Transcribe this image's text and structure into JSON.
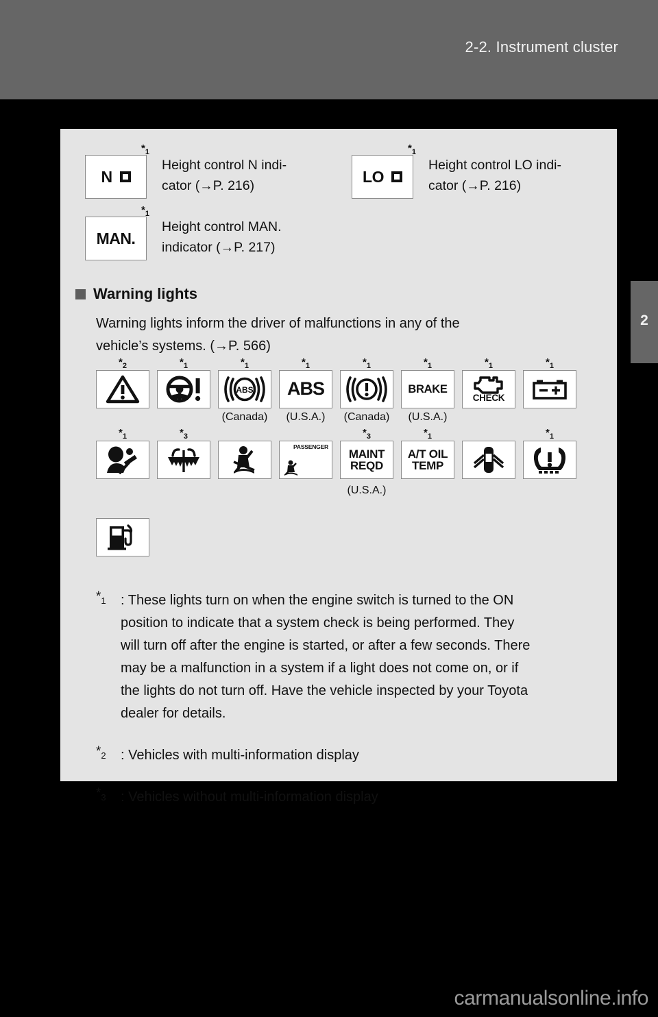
{
  "header": {
    "title": "2-2. Instrument cluster",
    "chapter_tab": "2"
  },
  "indicators": [
    {
      "icon_text": "N",
      "has_square": true,
      "footnote": "1",
      "label_line1": "Height control N indi-",
      "label_line2": "cator (→P. 216)"
    },
    {
      "icon_text": "LO",
      "has_square": true,
      "footnote": "1",
      "label_line1": "Height control LO indi-",
      "label_line2": "cator (→P. 216)"
    },
    {
      "icon_text": "MAN.",
      "has_square": false,
      "footnote": "1",
      "label_line1": "Height control MAN.",
      "label_line2": "indicator (→P. 217)"
    }
  ],
  "section": {
    "heading": "Warning lights",
    "body_line1": "Warning lights inform the driver of malfunctions in any of the",
    "body_line2": "vehicle’s systems. (→P. 566)"
  },
  "warning_lights": {
    "row1": [
      {
        "icon": "warning-triangle-icon",
        "footnote": "2",
        "region": ""
      },
      {
        "icon": "power-steering-icon",
        "footnote": "1",
        "region": ""
      },
      {
        "icon": "abs-circle-icon",
        "footnote": "1",
        "region": "(Canada)"
      },
      {
        "icon": "abs-text-icon",
        "text": "ABS",
        "footnote": "1",
        "region": "(U.S.A.)"
      },
      {
        "icon": "brake-circle-icon",
        "footnote": "1",
        "region": "(Canada)"
      },
      {
        "icon": "brake-text-icon",
        "text": "BRAKE",
        "footnote": "1",
        "region": "(U.S.A.)"
      },
      {
        "icon": "engine-check-icon",
        "text": "CHECK",
        "footnote": "1",
        "region": ""
      },
      {
        "icon": "battery-icon",
        "footnote": "1",
        "region": ""
      }
    ],
    "row2": [
      {
        "icon": "srs-airbag-icon",
        "footnote": "1",
        "region": ""
      },
      {
        "icon": "washer-fluid-icon",
        "footnote": "3",
        "region": ""
      },
      {
        "icon": "seat-belt-reminder-icon",
        "footnote": "",
        "region": ""
      },
      {
        "icon": "passenger-airbag-icon",
        "text": "PASSENGER",
        "footnote": "",
        "region": ""
      },
      {
        "icon": "maint-reqd-icon",
        "text_line1": "MAINT",
        "text_line2": "REQD",
        "footnote": "3",
        "region": "(U.S.A.)"
      },
      {
        "icon": "at-oil-temp-icon",
        "text_line1": "A/T OIL",
        "text_line2": "TEMP",
        "footnote": "1",
        "region": ""
      },
      {
        "icon": "door-open-icon",
        "footnote": "",
        "region": ""
      },
      {
        "icon": "tire-pressure-icon",
        "footnote": "1",
        "region": ""
      }
    ],
    "row3": [
      {
        "icon": "low-fuel-icon",
        "footnote": "",
        "region": ""
      }
    ]
  },
  "footnotes": [
    {
      "mark": "1",
      "lines": [
        ": These lights turn on when the engine switch is turned to the ON",
        "position to indicate that a system check is being performed. They",
        "will turn off after the engine is started, or after a few seconds. There",
        "may be a malfunction in a system if a light does not come on, or if",
        "the lights do not turn off. Have the vehicle inspected by your Toyota",
        "dealer for details."
      ]
    },
    {
      "mark": "2",
      "lines": [
        ": Vehicles with multi-information display"
      ]
    },
    {
      "mark": "3",
      "lines": [
        ": Vehicles without multi-information display"
      ]
    }
  ],
  "watermark": "carmanualsonline.info",
  "colors": {
    "header_bg": "#666666",
    "page_bg": "#000000",
    "panel_bg": "#e4e4e4",
    "icon_box_bg": "#ffffff",
    "ink": "#111111"
  }
}
